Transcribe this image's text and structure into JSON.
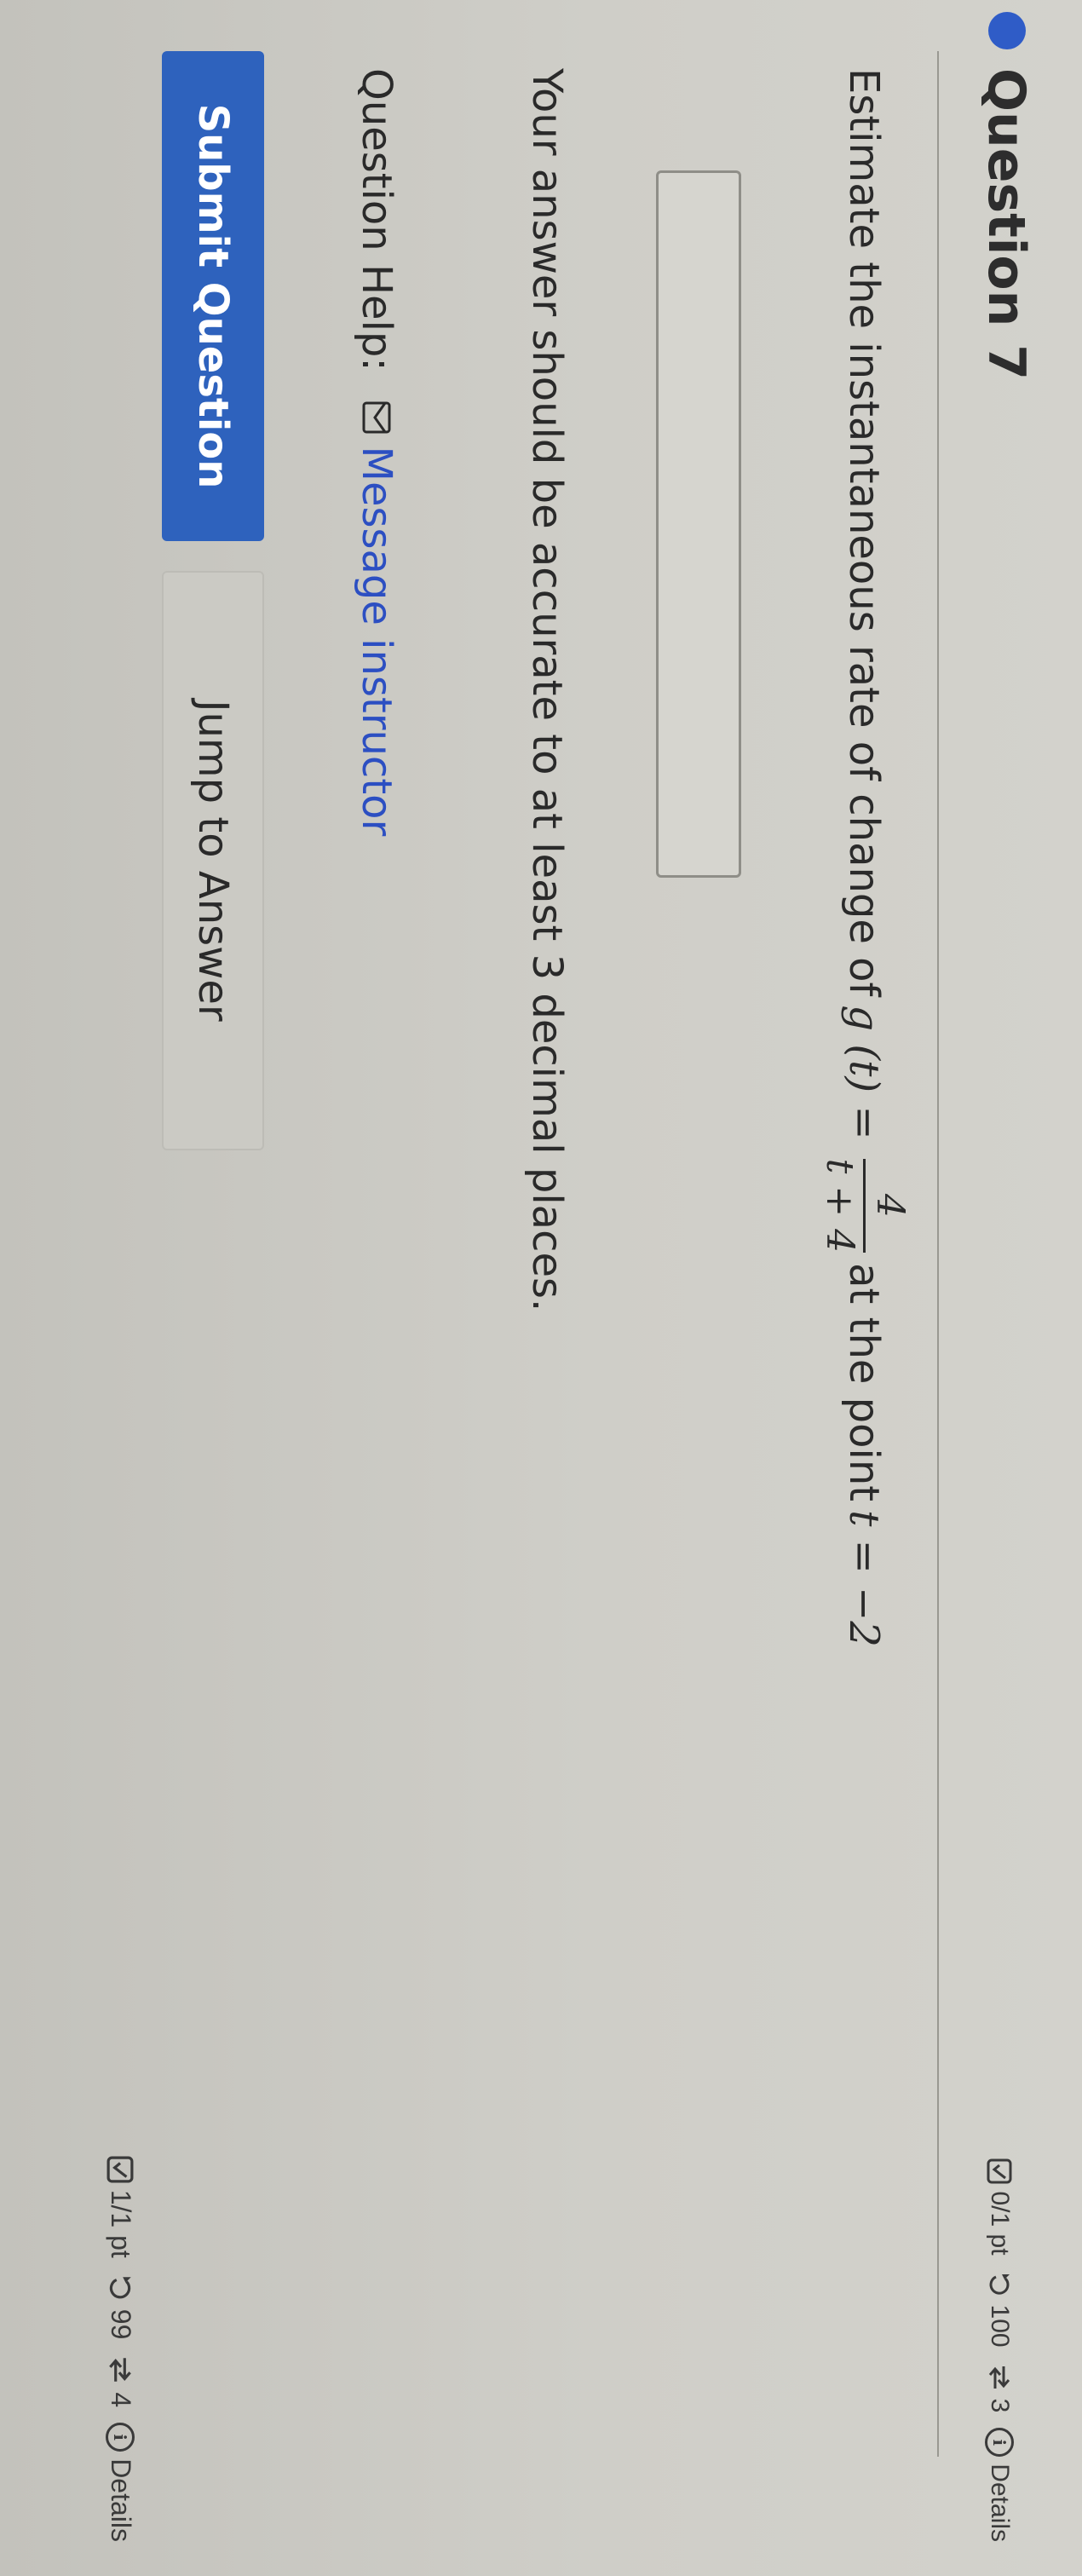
{
  "question": {
    "title": "Question 7",
    "score_top": "0/1 pt",
    "attempts_top": "100",
    "retries_top": "3",
    "details_top": "Details",
    "prompt_before": "Estimate the instantaneous rate of change of",
    "func_lhs": "g (t) =",
    "frac_num": "4",
    "frac_den": "t + 4",
    "prompt_mid": "at the point",
    "point_expr": "t = −2",
    "answer_value": "",
    "accuracy_note": "Your answer should be accurate to at least 3 decimal places.",
    "help_label": "Question Help:",
    "message_link": "Message instructor",
    "submit_label": "Submit Question",
    "jump_label": "Jump to Answer",
    "score_bottom": "1/1 pt",
    "attempts_bottom": "99",
    "retries_bottom": "4",
    "details_bottom": "Details"
  },
  "colors": {
    "accent": "#2e62bd",
    "link": "#2c4fc2",
    "dot": "#2f5cc7"
  },
  "icons": [
    "check-square-icon",
    "undo-icon",
    "retry-icon",
    "info-icon",
    "mail-icon"
  ]
}
